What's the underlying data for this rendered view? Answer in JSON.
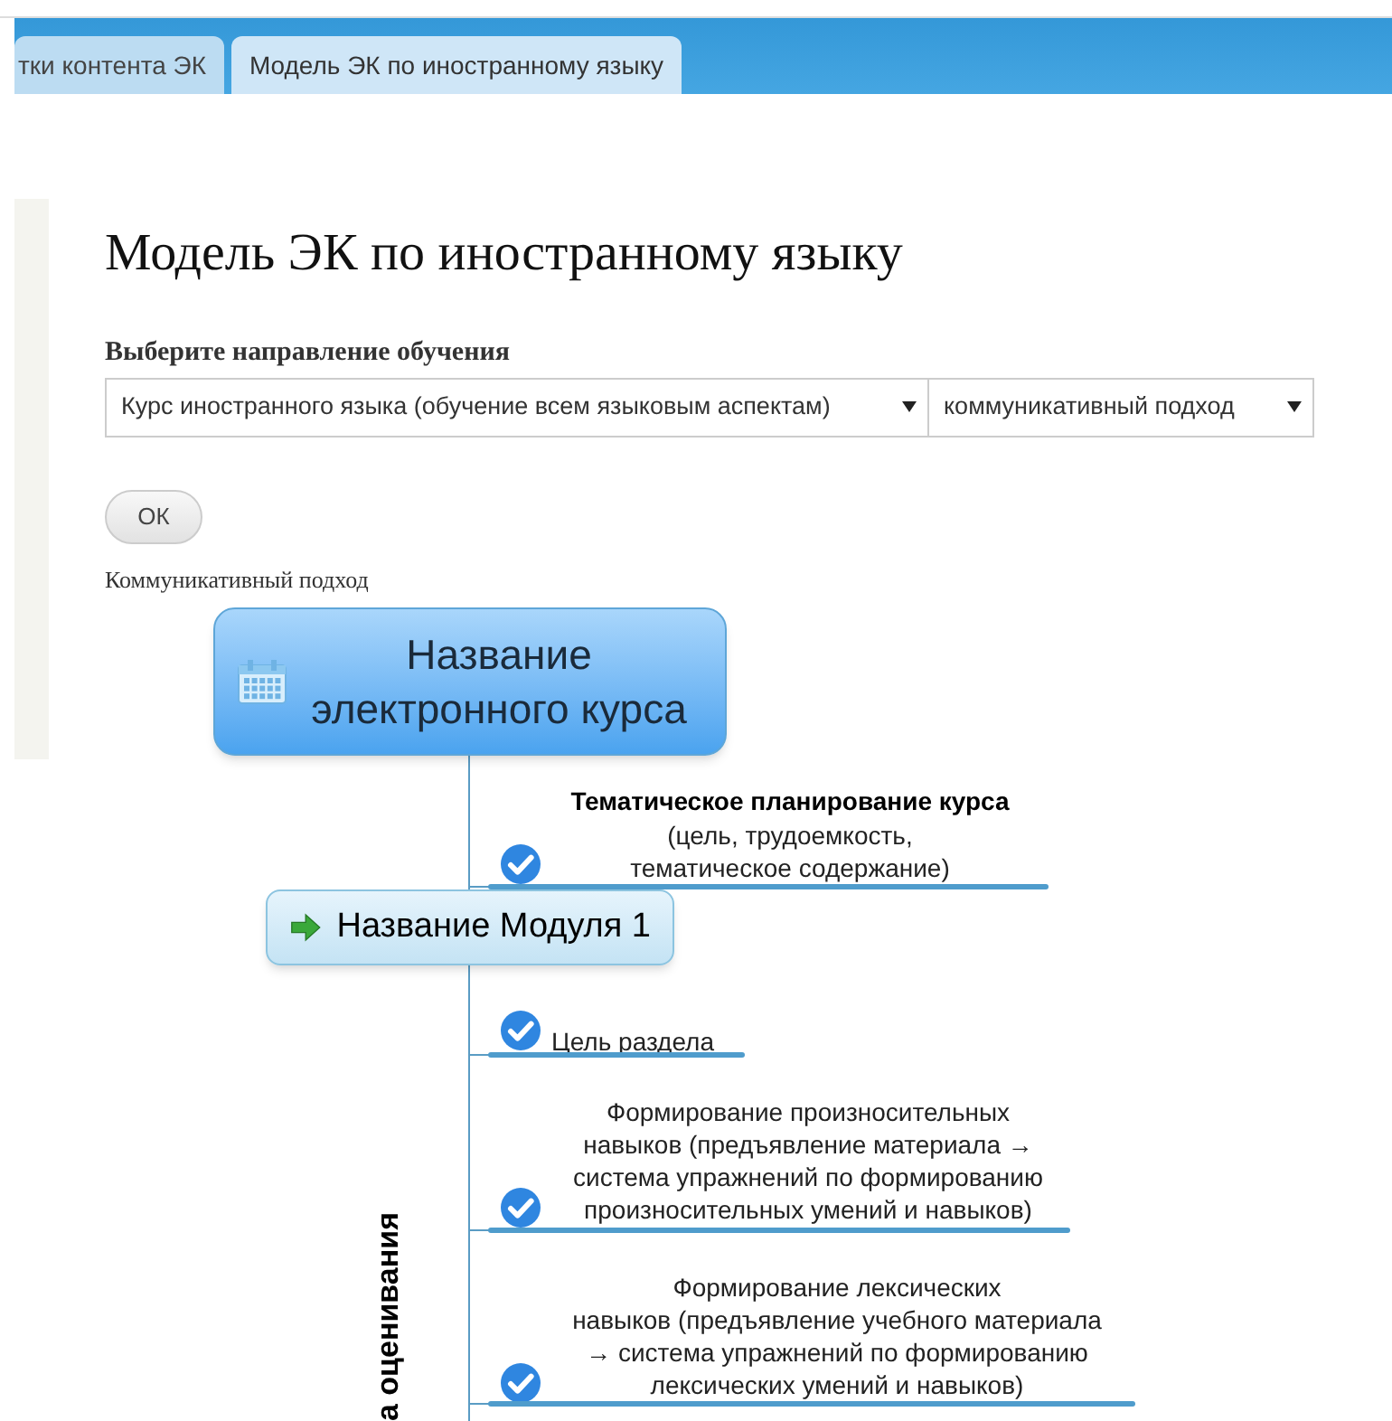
{
  "tabs": [
    {
      "label": "тки контента ЭК",
      "selected": false
    },
    {
      "label": "Модель ЭК по иностранному языку",
      "selected": true
    }
  ],
  "page": {
    "title": "Модель ЭК по иностранному языку",
    "direction_label": "Выберите направление обучения",
    "selects": [
      {
        "value": "Курс иностранного языка (обучение всем языковым аспектам)"
      },
      {
        "value": "коммуникативный подход"
      }
    ],
    "ok_button": "ОК",
    "approach_caption": "Коммуникативный подход"
  },
  "mind_map": {
    "root": [
      "Название",
      "электронного курса"
    ],
    "side_label": "а оценивания",
    "nodes": [
      {
        "kind": "topic",
        "title": "Тематическое планирование курса",
        "lines": [
          "(цель, трудоемкость,",
          "тематическое содержание)"
        ]
      },
      {
        "kind": "module",
        "text": "Название Модуля 1"
      },
      {
        "kind": "item",
        "lines": [
          "Цель раздела"
        ]
      },
      {
        "kind": "item",
        "lines": [
          "Формирование произносительных",
          "навыков (предъявление материала →",
          "система упражнений по формированию",
          "произносительных умений и навыков)"
        ]
      },
      {
        "kind": "item",
        "lines": [
          "Формирование лексических",
          "навыков (предъявление учебного материала",
          "→ система упражнений по формированию",
          "лексических умений и навыков)"
        ]
      }
    ]
  }
}
